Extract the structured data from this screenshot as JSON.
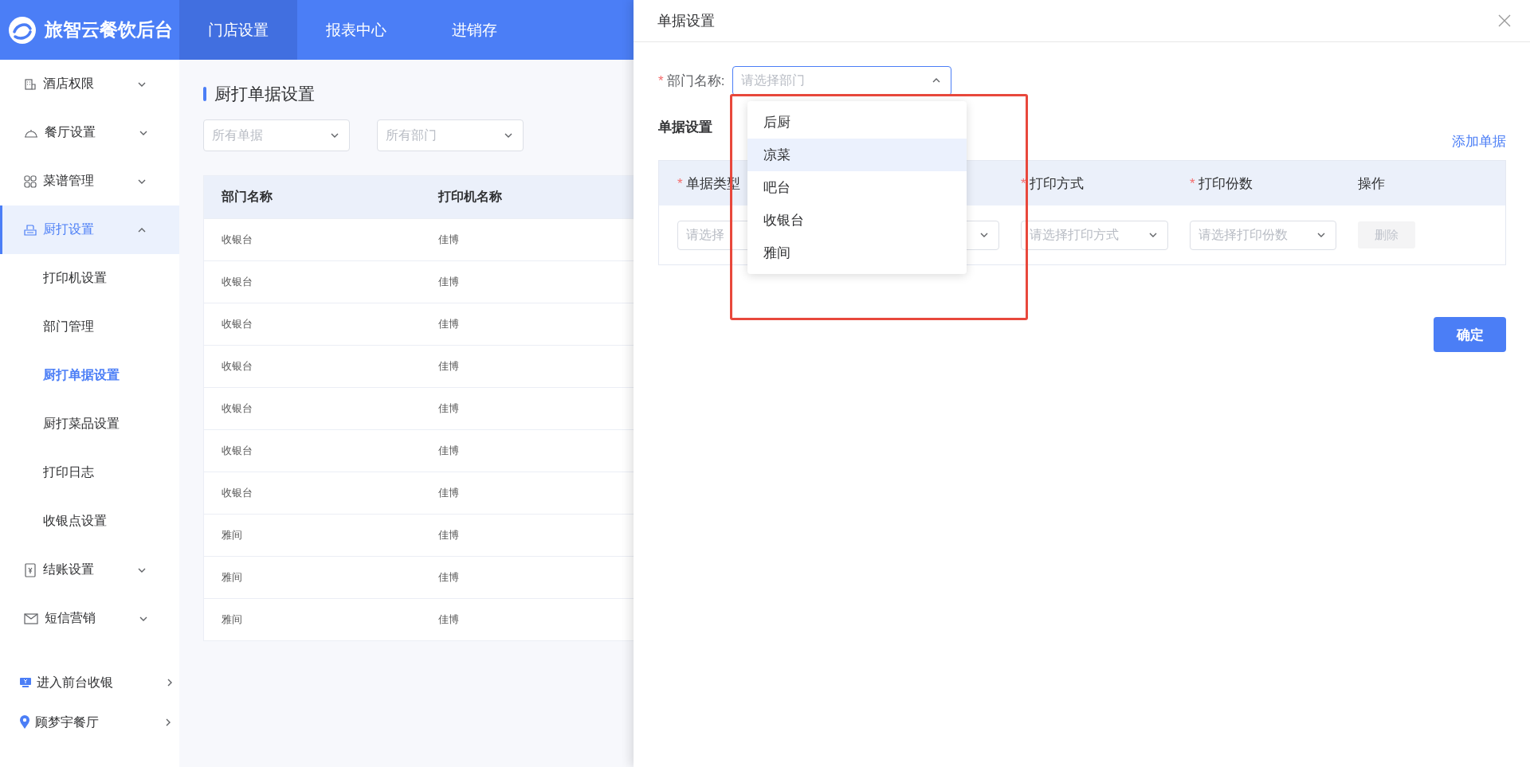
{
  "header": {
    "brand": "旅智云餐饮后台",
    "tabs": [
      {
        "label": "门店设置",
        "selected": true
      },
      {
        "label": "报表中心",
        "selected": false
      },
      {
        "label": "进销存",
        "selected": false
      }
    ]
  },
  "sidebar": {
    "groups": [
      {
        "label": "酒店权限",
        "expanded": false,
        "selected": false
      },
      {
        "label": "餐厅设置",
        "expanded": false,
        "selected": false
      },
      {
        "label": "菜谱管理",
        "expanded": false,
        "selected": false
      },
      {
        "label": "厨打设置",
        "expanded": true,
        "selected": true,
        "children": [
          {
            "label": "打印机设置",
            "selected": false
          },
          {
            "label": "部门管理",
            "selected": false
          },
          {
            "label": "厨打单据设置",
            "selected": true
          },
          {
            "label": "厨打菜品设置",
            "selected": false
          },
          {
            "label": "打印日志",
            "selected": false
          },
          {
            "label": "收银点设置",
            "selected": false
          }
        ]
      },
      {
        "label": "结账设置",
        "expanded": false,
        "selected": false
      },
      {
        "label": "短信营销",
        "expanded": false,
        "selected": false
      }
    ],
    "links": [
      {
        "label": "进入前台收银"
      },
      {
        "label": "顾梦宇餐厅"
      }
    ]
  },
  "main": {
    "title": "厨打单据设置",
    "filters": [
      {
        "placeholder": "所有单据"
      },
      {
        "placeholder": "所有部门"
      }
    ],
    "table": {
      "columns": [
        "部门名称",
        "打印机名称"
      ],
      "rows": [
        [
          "收银台",
          "佳博"
        ],
        [
          "收银台",
          "佳博"
        ],
        [
          "收银台",
          "佳博"
        ],
        [
          "收银台",
          "佳博"
        ],
        [
          "收银台",
          "佳博"
        ],
        [
          "收银台",
          "佳博"
        ],
        [
          "收银台",
          "佳博"
        ],
        [
          "雅间",
          "佳博"
        ],
        [
          "雅间",
          "佳博"
        ],
        [
          "雅间",
          "佳博"
        ]
      ]
    }
  },
  "drawer": {
    "title": "单据设置",
    "required_mark": "*",
    "department": {
      "label": "部门名称:",
      "required": true,
      "placeholder": "请选择部门",
      "open": true,
      "options": [
        {
          "label": "后厨",
          "selected": false
        },
        {
          "label": "凉菜",
          "selected": true
        },
        {
          "label": "吧台",
          "selected": false
        },
        {
          "label": "收银台",
          "selected": false
        },
        {
          "label": "雅间",
          "selected": false
        }
      ]
    },
    "section_title": "单据设置",
    "add_link": "添加单据",
    "columns": [
      {
        "label": "单据类型",
        "required": true
      },
      {
        "label": "打印方式",
        "required": true
      },
      {
        "label": "打印份数",
        "required": true
      },
      {
        "label": "操作",
        "required": false
      }
    ],
    "row": {
      "fields": [
        {
          "kind": "covered_select",
          "placeholder": "请选择"
        },
        {
          "kind": "select"
        },
        {
          "kind": "select",
          "placeholder": "请选择打印方式"
        },
        {
          "kind": "select",
          "placeholder": "请选择打印份数"
        }
      ],
      "delete": {
        "label": "删除",
        "disabled": true
      }
    },
    "confirm": "确定"
  }
}
